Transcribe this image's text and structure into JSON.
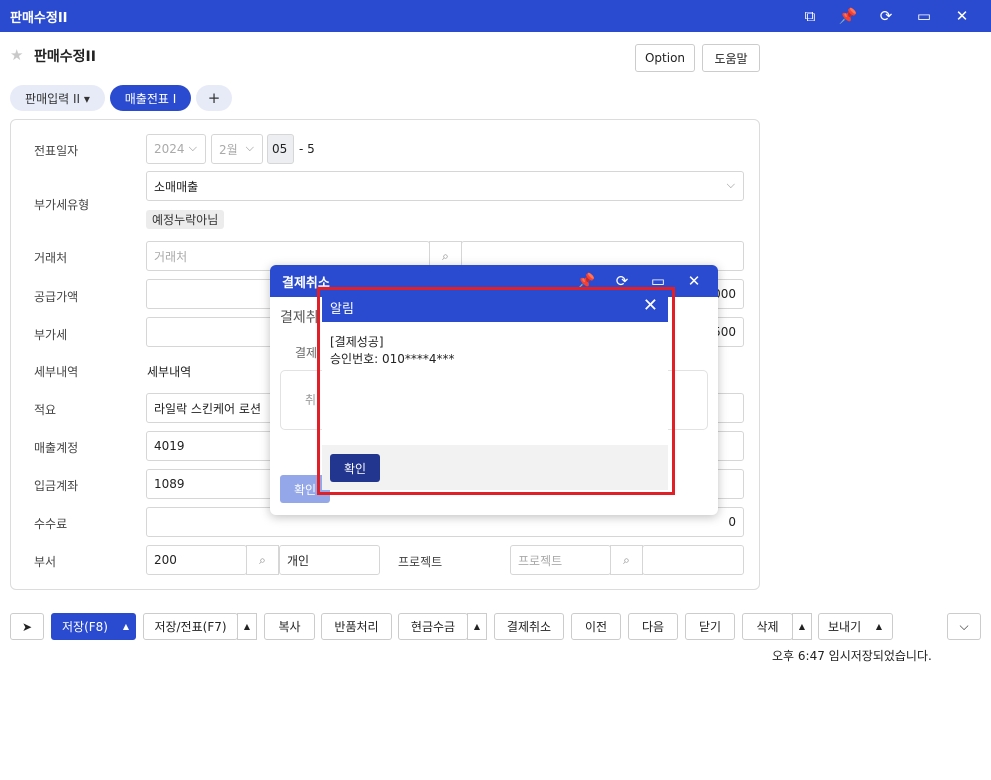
{
  "window": {
    "title": "판매수정II",
    "icons": [
      "external-link-icon",
      "pin-icon",
      "refresh-icon",
      "maximize-icon",
      "close-icon"
    ]
  },
  "page": {
    "title": "판매수정II",
    "option_label": "Option",
    "help_label": "도움말"
  },
  "tabs": [
    {
      "label": "판매입력 II ▾"
    },
    {
      "label": "매출전표 I"
    },
    {
      "label": "+"
    }
  ],
  "form": {
    "date": {
      "label": "전표일자",
      "year": "2024",
      "month": "2월",
      "day": "05",
      "seq": "- 5"
    },
    "vat_type": {
      "label": "부가세유형",
      "value": "소매매출",
      "badge": "예정누락아님"
    },
    "client": {
      "label": "거래처",
      "placeholder": "거래처"
    },
    "supply_amount": {
      "label": "공급가액",
      "value": "000"
    },
    "vat": {
      "label": "부가세",
      "value": "500"
    },
    "tax_detail": {
      "label": "세부내역",
      "value": "세부내역"
    },
    "memo": {
      "label": "적요",
      "value": "라일락 스킨케어 로션"
    },
    "sales_account": {
      "label": "매출계정",
      "value": "4019"
    },
    "deposit_account": {
      "label": "입금계좌",
      "value": "1089"
    },
    "fee": {
      "label": "수수료",
      "value": "0"
    },
    "dept": {
      "label": "부서",
      "value": "200",
      "name": "개인"
    },
    "project": {
      "label": "프로젝트",
      "placeholder": "프로젝트"
    }
  },
  "toolbar": {
    "save": "저장(F8)",
    "save_slip": "저장/전표(F7)",
    "copy": "복사",
    "return": "반품처리",
    "cash": "현금수금",
    "cancel_pay": "결제취소",
    "prev": "이전",
    "next": "다음",
    "close": "닫기",
    "delete": "삭제",
    "send": "보내기"
  },
  "status": {
    "text": "오후 6:47 임시저장되었습니다."
  },
  "cancel_dialog": {
    "title": "결제취소",
    "subtitle": "결제취",
    "row_label": "결제",
    "inner_label": "취",
    "confirm": "확인"
  },
  "alert": {
    "title": "알림",
    "line1": "[결제성공]",
    "line2": "승인번호: 010****4***",
    "ok": "확인"
  }
}
